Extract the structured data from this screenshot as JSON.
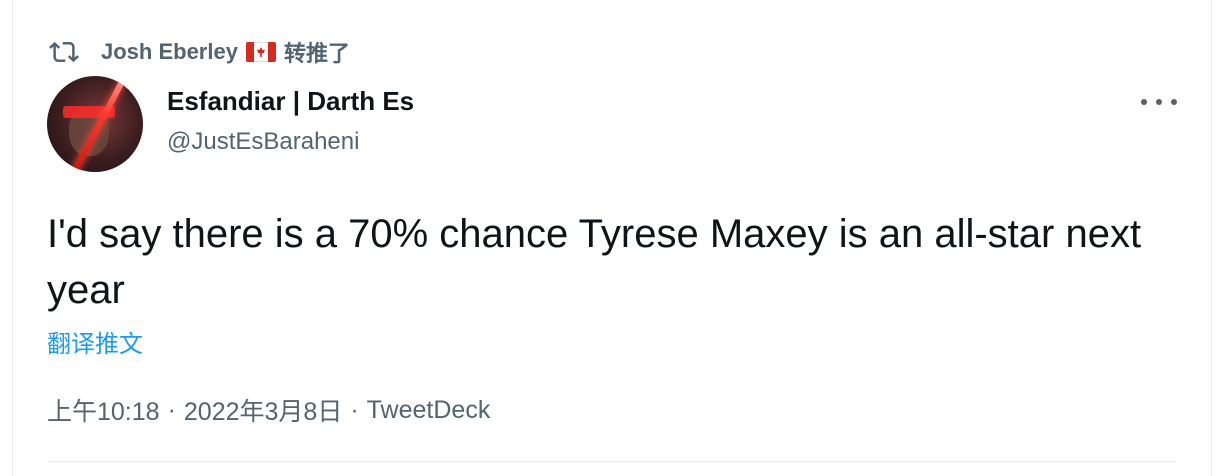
{
  "retweet": {
    "user": "Josh Eberley",
    "flag_icon": "canada-flag-icon",
    "action": "转推了"
  },
  "author": {
    "name": "Esfandiar | Darth Es",
    "handle": "@JustEsBaraheni"
  },
  "tweet": {
    "text": "I'd say there is a 70% chance Tyrese Maxey is an all-star next year",
    "translate_label": "翻译推文"
  },
  "meta": {
    "time": "上午10:18",
    "date": "2022年3月8日",
    "source": "TweetDeck",
    "separator": "·"
  },
  "colors": {
    "text": "#0f1419",
    "secondary": "#536471",
    "link": "#1d9bf0",
    "divider": "#e6ecf0"
  }
}
